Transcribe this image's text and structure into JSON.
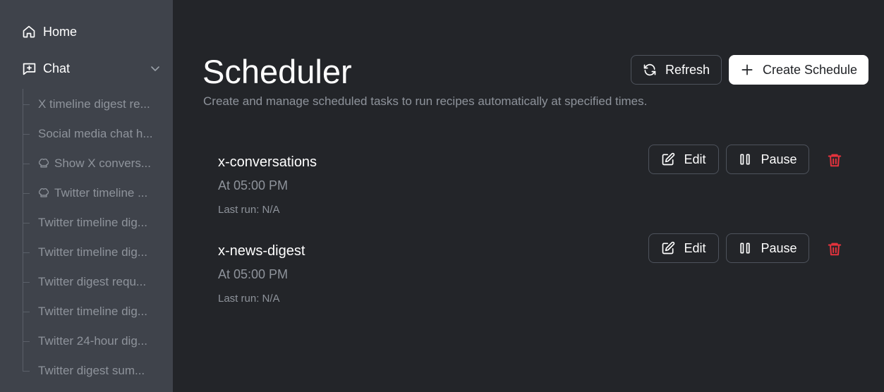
{
  "sidebar": {
    "home_label": "Home",
    "chat_label": "Chat",
    "history": [
      {
        "label": "X timeline digest re...",
        "icon": "none"
      },
      {
        "label": "Social media chat h...",
        "icon": "none"
      },
      {
        "label": "Show X convers...",
        "icon": "recipe-icon"
      },
      {
        "label": "Twitter timeline ...",
        "icon": "recipe-icon"
      },
      {
        "label": "Twitter timeline dig...",
        "icon": "none"
      },
      {
        "label": "Twitter timeline dig...",
        "icon": "none"
      },
      {
        "label": "Twitter digest requ...",
        "icon": "none"
      },
      {
        "label": "Twitter timeline dig...",
        "icon": "none"
      },
      {
        "label": "Twitter 24-hour dig...",
        "icon": "none"
      },
      {
        "label": "Twitter digest sum...",
        "icon": "none"
      }
    ]
  },
  "header": {
    "title": "Scheduler",
    "subtitle": "Create and manage scheduled tasks to run recipes automatically at specified times.",
    "refresh_label": "Refresh",
    "create_label": "Create Schedule"
  },
  "schedules": [
    {
      "name": "x-conversations",
      "time": "At 05:00 PM",
      "last_run": "Last run: N/A",
      "edit_label": "Edit",
      "pause_label": "Pause"
    },
    {
      "name": "x-news-digest",
      "time": "At 05:00 PM",
      "last_run": "Last run: N/A",
      "edit_label": "Edit",
      "pause_label": "Pause"
    }
  ],
  "colors": {
    "background": "#232529",
    "sidebar": "#3f434b",
    "muted_text": "#8e939b",
    "danger": "#e5333d",
    "primary_button": "#ffffff"
  }
}
